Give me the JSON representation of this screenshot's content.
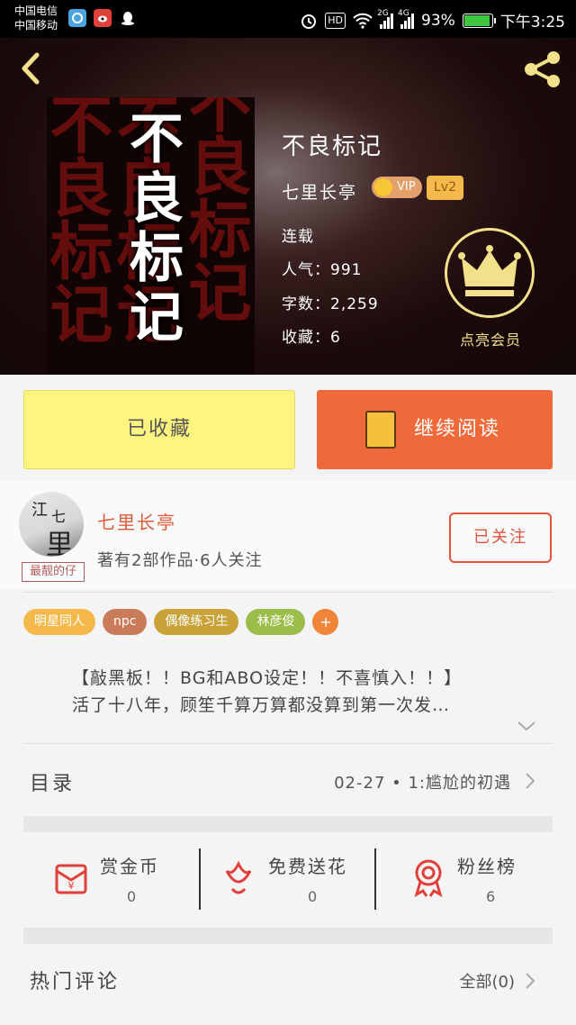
{
  "status_bar": {
    "carrier1": "中国电信",
    "carrier2": "中国移动",
    "hd": "HD",
    "net1": "2G",
    "net2": "4G",
    "battery_pct": "93%",
    "battery_level": 0.93,
    "time": "下午3:25"
  },
  "cover": {
    "title_chars": "不良标记",
    "bg_text": "不良标记不良标记"
  },
  "book": {
    "title": "不良标记",
    "author": "七里长亭",
    "vip": "VIP",
    "level": "Lv2",
    "status": "连载",
    "popularity": "人气：991",
    "word_count": "字数：2,259",
    "favorites": "收藏：6"
  },
  "vip_button": {
    "label": "点亮会员"
  },
  "actions": {
    "favorited": "已收藏",
    "continue": "继续阅读"
  },
  "author": {
    "name": "七里长亭",
    "meta": "著有2部作品·6人关注",
    "follow": "已关注",
    "avatar_text_top": "江",
    "avatar_text_mid": "七",
    "avatar_text_big": "里",
    "avatar_tag": "最靓的仔"
  },
  "tags": [
    {
      "label": "明星同人",
      "color": "#f5b84a"
    },
    {
      "label": "npc",
      "color": "#c97b5a"
    },
    {
      "label": "偶像练习生",
      "color": "#c9a33a"
    },
    {
      "label": "林彦俊",
      "color": "#9bbd4a"
    },
    {
      "label": "+",
      "color": "#f0853a"
    }
  ],
  "intro": {
    "line1": "【敲黑板！！BG和ABO设定！！不喜慎入！！】",
    "line2": "活了十八年，顾笙千算万算都没算到第一次发…"
  },
  "toc": {
    "label": "目录",
    "latest": "02-27 • 1:尴尬的初遇"
  },
  "stats": [
    {
      "label": "赏金币",
      "value": "0"
    },
    {
      "label": "免费送花",
      "value": "0"
    },
    {
      "label": "粉丝榜",
      "value": "6"
    }
  ],
  "comments": {
    "label": "热门评论",
    "all": "全部(0)"
  }
}
